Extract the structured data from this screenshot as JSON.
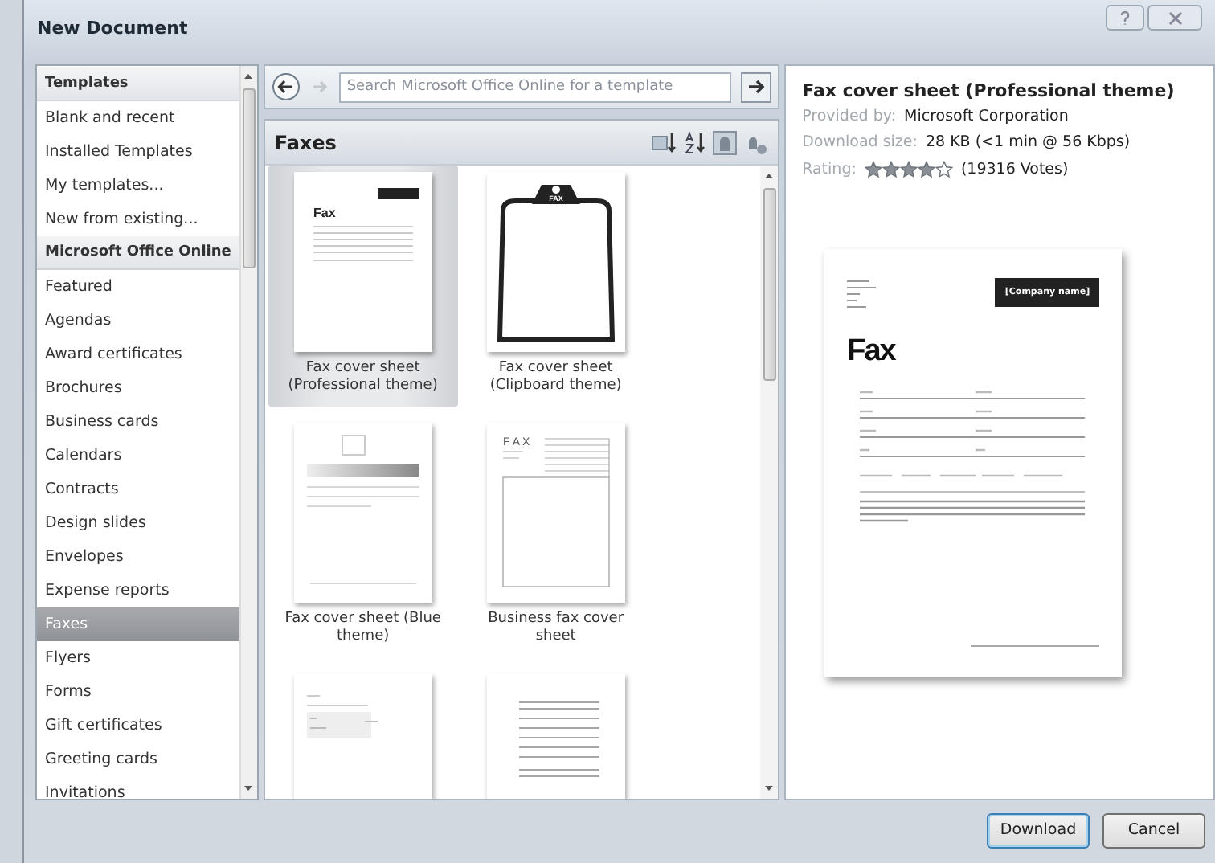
{
  "window": {
    "title": "New Document"
  },
  "sidebar": {
    "items": [
      {
        "label": "Templates",
        "kind": "header",
        "selected": false
      },
      {
        "label": "Blank and recent",
        "kind": "item",
        "selected": false
      },
      {
        "label": "Installed Templates",
        "kind": "item",
        "selected": false
      },
      {
        "label": "My templates...",
        "kind": "item",
        "selected": false
      },
      {
        "label": "New from existing...",
        "kind": "item",
        "selected": false
      },
      {
        "label": "Microsoft Office Online",
        "kind": "header",
        "selected": false
      },
      {
        "label": "Featured",
        "kind": "item",
        "selected": false
      },
      {
        "label": "Agendas",
        "kind": "item",
        "selected": false
      },
      {
        "label": "Award certificates",
        "kind": "item",
        "selected": false
      },
      {
        "label": "Brochures",
        "kind": "item",
        "selected": false
      },
      {
        "label": "Business cards",
        "kind": "item",
        "selected": false
      },
      {
        "label": "Calendars",
        "kind": "item",
        "selected": false
      },
      {
        "label": "Contracts",
        "kind": "item",
        "selected": false
      },
      {
        "label": "Design slides",
        "kind": "item",
        "selected": false
      },
      {
        "label": "Envelopes",
        "kind": "item",
        "selected": false
      },
      {
        "label": "Expense reports",
        "kind": "item",
        "selected": false
      },
      {
        "label": "Faxes",
        "kind": "item",
        "selected": true
      },
      {
        "label": "Flyers",
        "kind": "item",
        "selected": false
      },
      {
        "label": "Forms",
        "kind": "item",
        "selected": false
      },
      {
        "label": "Gift certificates",
        "kind": "item",
        "selected": false
      },
      {
        "label": "Greeting cards",
        "kind": "item",
        "selected": false
      },
      {
        "label": "Invitations",
        "kind": "item",
        "selected": false
      }
    ]
  },
  "search": {
    "placeholder": "Search Microsoft Office Online for a template"
  },
  "gallery": {
    "title": "Faxes",
    "items": [
      {
        "caption": "Fax cover sheet (Professional theme)",
        "selected": true,
        "kind": "professional",
        "heading": "Fax"
      },
      {
        "caption": "Fax cover sheet (Clipboard theme)",
        "selected": false,
        "kind": "clipboard",
        "heading": "FAX"
      },
      {
        "caption": "Fax cover sheet (Blue theme)",
        "selected": false,
        "kind": "blue"
      },
      {
        "caption": "Business fax cover sheet",
        "selected": false,
        "kind": "business",
        "heading": "F A X"
      },
      {
        "selected": false,
        "kind": "form"
      },
      {
        "selected": false,
        "kind": "lined"
      }
    ]
  },
  "details": {
    "title": "Fax cover sheet (Professional theme)",
    "provided_by_label": "Provided by:",
    "provided_by": "Microsoft Corporation",
    "size_label": "Download size:",
    "size": "28 KB (<1 min @ 56 Kbps)",
    "rating_label": "Rating:",
    "stars": 4,
    "votes": "(19316 Votes)",
    "preview": {
      "heading": "Fax",
      "company": "[Company name]"
    }
  },
  "buttons": [
    {
      "label": "Download",
      "kind": "default"
    },
    {
      "label": "Cancel",
      "kind": "normal"
    }
  ]
}
